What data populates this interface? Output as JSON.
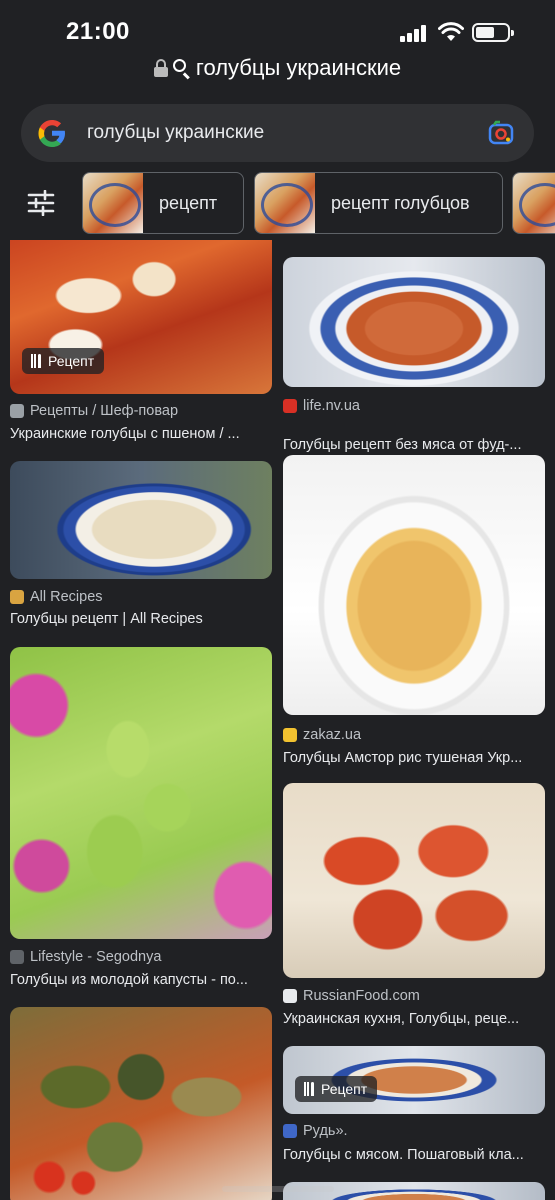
{
  "status": {
    "time": "21:00"
  },
  "browser": {
    "url_text": "голубцы украинские"
  },
  "search": {
    "query": "голубцы украинские"
  },
  "filters": {
    "chips": [
      {
        "label": "рецепт"
      },
      {
        "label": "рецепт голубцов"
      }
    ]
  },
  "results": {
    "left": [
      {
        "source": "Рецепты / Шеф-повар",
        "title": "Украинские голубцы с пшеном / ...",
        "badge": "Рецепт",
        "favicon_color": "#9aa0a6"
      },
      {
        "source": "All Recipes",
        "title": "Голубцы рецепт | All Recipes",
        "favicon_color": "#d9a441"
      },
      {
        "source": "Lifestyle - Segodnya",
        "title": "Голубцы из молодой капусты - по...",
        "favicon_color": "#5f6368"
      },
      {
        "source": "",
        "title": "",
        "favicon_color": ""
      }
    ],
    "right": [
      {
        "source": "life.nv.ua",
        "title": "Голубцы рецепт без мяса от фуд-...",
        "favicon_color": "#d93025",
        "favicon_text": "NV"
      },
      {
        "source": "zakaz.ua",
        "title": "Голубцы Амстор рис тушеная Укр...",
        "favicon_color": "#f2c230"
      },
      {
        "source": "RussianFood.com",
        "title": "Украинская кухня, Голубцы, рецe...",
        "favicon_color": "#e8eaed"
      },
      {
        "source": "Рудь».",
        "title": "Голубцы с мясом. Пошаговый кла...",
        "badge": "Рецепт",
        "favicon_color": "#3f67c8"
      }
    ]
  }
}
